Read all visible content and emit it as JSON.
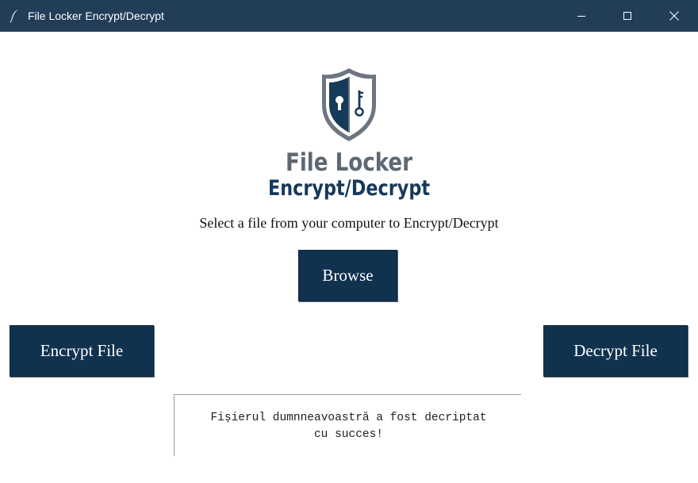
{
  "window": {
    "title": "File Locker Encrypt/Decrypt",
    "app_icon": "feather-icon",
    "controls": [
      "minimize-icon",
      "maximize-icon",
      "close-icon"
    ]
  },
  "logo": {
    "line1": "File Locker",
    "line2": "Encrypt/Decrypt",
    "emblem": "shield-lock-key-icon"
  },
  "instruction": "Select a file from your computer to Encrypt/Decrypt",
  "buttons": {
    "browse": "Browse",
    "encrypt": "Encrypt File",
    "decrypt": "Decrypt File"
  },
  "output": {
    "line1": "Fișierul dumnneavoastră a fost decriptat",
    "line2": "cu succes!"
  },
  "colors": {
    "titlebar": "#223d58",
    "button": "#11324f",
    "logo_text_top": "#5d6872",
    "logo_text_bottom": "#16395a"
  }
}
